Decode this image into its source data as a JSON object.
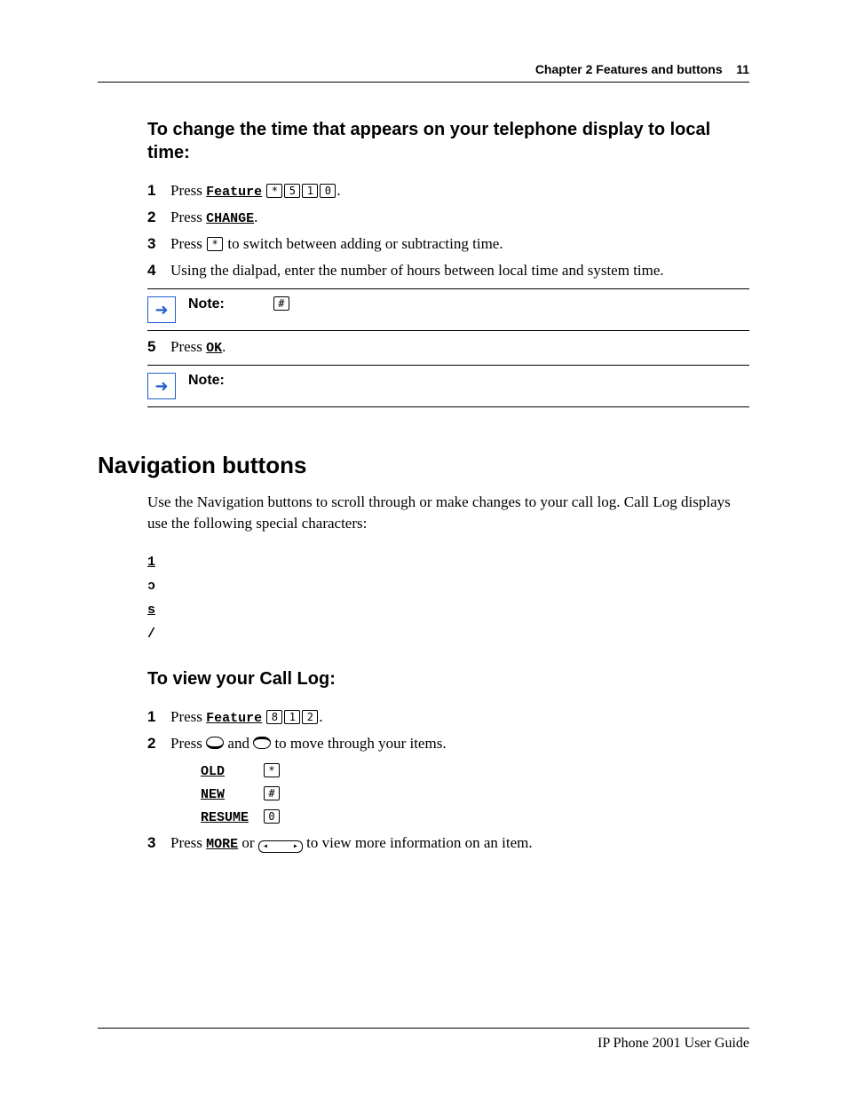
{
  "header": {
    "chapter": "Chapter 2  Features and buttons",
    "page": "11"
  },
  "section1": {
    "title": "To change the time that appears on your telephone display to local time:",
    "steps": [
      {
        "n": "1",
        "pre": "Press ",
        "soft": "Feature",
        "keys": [
          "*",
          "5",
          "1",
          "0"
        ],
        "post": "."
      },
      {
        "n": "2",
        "pre": "Press ",
        "soft": "CHANGE",
        "post": "."
      },
      {
        "n": "3",
        "pre": "Press ",
        "keys": [
          "*"
        ],
        "post": " to switch between adding or subtracting time."
      },
      {
        "n": "4",
        "text": "Using the dialpad, enter the number of hours between local time and system time."
      }
    ],
    "note1_label": "Note:",
    "note1_key": "#",
    "step5": {
      "n": "5",
      "pre": "Press ",
      "soft": "OK",
      "post": "."
    },
    "note2_label": "Note:"
  },
  "section2": {
    "title": "Navigation buttons",
    "intro": "Use the Navigation buttons to scroll through or make changes to your call log. Call Log displays use the following special characters:",
    "specials": [
      "1",
      "ↄ",
      "s",
      "/"
    ]
  },
  "section3": {
    "title": "To view your Call Log:",
    "step1": {
      "n": "1",
      "pre": "Press ",
      "soft": "Feature",
      "keys": [
        "8",
        "1",
        "2"
      ],
      "post": "."
    },
    "step2": {
      "n": "2",
      "pre": "Press ",
      "mid": " and ",
      "post": " to move through your items."
    },
    "sublist": [
      {
        "soft": "OLD",
        "key": "*"
      },
      {
        "soft": "NEW",
        "key": "#"
      },
      {
        "soft": "RESUME",
        "key": "0"
      }
    ],
    "step3": {
      "n": "3",
      "pre": "Press ",
      "soft": "MORE",
      "mid": " or ",
      "post": " to view more information on an item."
    }
  },
  "footer": "IP Phone 2001 User Guide"
}
